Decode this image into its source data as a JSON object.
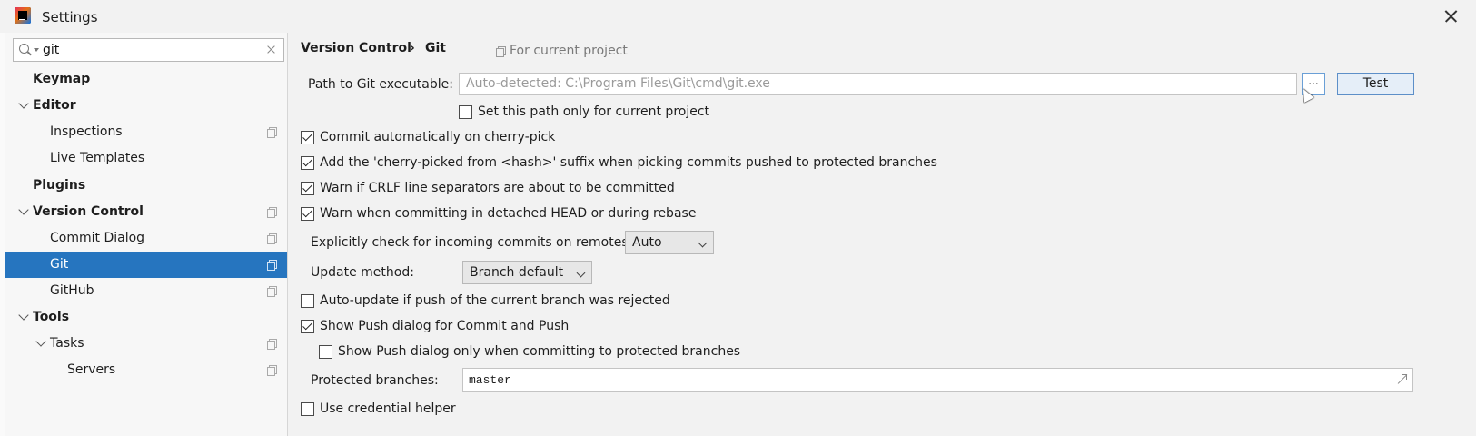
{
  "window": {
    "title": "Settings",
    "app_icon": "intellij-icon",
    "close_icon": "close-icon"
  },
  "sidebar": {
    "search": {
      "value": "git",
      "placeholder": ""
    },
    "items": [
      {
        "label": "Keymap",
        "bold": true,
        "expanded": null,
        "has_copy_icon": false,
        "selected": false
      },
      {
        "label": "Editor",
        "bold": true,
        "expanded": true,
        "has_copy_icon": false,
        "selected": false
      },
      {
        "label": "Inspections",
        "bold": false,
        "expanded": null,
        "has_copy_icon": true,
        "selected": false
      },
      {
        "label": "Live Templates",
        "bold": false,
        "expanded": null,
        "has_copy_icon": false,
        "selected": false
      },
      {
        "label": "Plugins",
        "bold": true,
        "expanded": null,
        "has_copy_icon": false,
        "selected": false
      },
      {
        "label": "Version Control",
        "bold": true,
        "expanded": true,
        "has_copy_icon": true,
        "selected": false
      },
      {
        "label": "Commit Dialog",
        "bold": false,
        "expanded": null,
        "has_copy_icon": true,
        "selected": false
      },
      {
        "label": "Git",
        "bold": false,
        "expanded": null,
        "has_copy_icon": true,
        "selected": true
      },
      {
        "label": "GitHub",
        "bold": false,
        "expanded": null,
        "has_copy_icon": true,
        "selected": false
      },
      {
        "label": "Tools",
        "bold": true,
        "expanded": true,
        "has_copy_icon": false,
        "selected": false
      },
      {
        "label": "Tasks",
        "bold": false,
        "expanded": true,
        "has_copy_icon": true,
        "selected": false
      },
      {
        "label": "Servers",
        "bold": false,
        "expanded": null,
        "has_copy_icon": true,
        "selected": false
      }
    ]
  },
  "header": {
    "breadcrumb": [
      "Version Control",
      "Git"
    ],
    "separator": "›",
    "scope_label": "For current project"
  },
  "git": {
    "path_label": "Path to Git executable:",
    "path_value": "Auto-detected: C:\\Program Files\\Git\\cmd\\git.exe",
    "browse_label": "...",
    "test_label": "Test",
    "path_only_project": {
      "label": "Set this path only for current project",
      "checked": false
    },
    "commit_cherry_pick": {
      "label": "Commit automatically on cherry-pick",
      "checked": true
    },
    "cherry_picked_suffix": {
      "label": "Add the 'cherry-picked from <hash>' suffix when picking commits pushed to protected branches",
      "checked": true
    },
    "warn_crlf": {
      "label": "Warn if CRLF line separators are about to be committed",
      "checked": true
    },
    "warn_detached": {
      "label": "Warn when committing in detached HEAD or during rebase",
      "checked": true
    },
    "incoming_label": "Explicitly check for incoming commits on remotes:",
    "incoming_value": "Auto",
    "update_method_label": "Update method:",
    "update_method_value": "Branch default",
    "auto_update": {
      "label": "Auto-update if push of the current branch was rejected",
      "checked": false
    },
    "show_push": {
      "label": "Show Push dialog for Commit and Push",
      "checked": true
    },
    "show_push_protected": {
      "label": "Show Push dialog only when committing to protected branches",
      "checked": false
    },
    "protected_label": "Protected branches:",
    "protected_value": "master",
    "credential_helper": {
      "label": "Use credential helper",
      "checked": false
    }
  },
  "colors": {
    "selection": "#2675bf",
    "background": "#f2f2f2",
    "sidebar": "#f7f7f7",
    "button_focus": "#5d8fc8"
  }
}
